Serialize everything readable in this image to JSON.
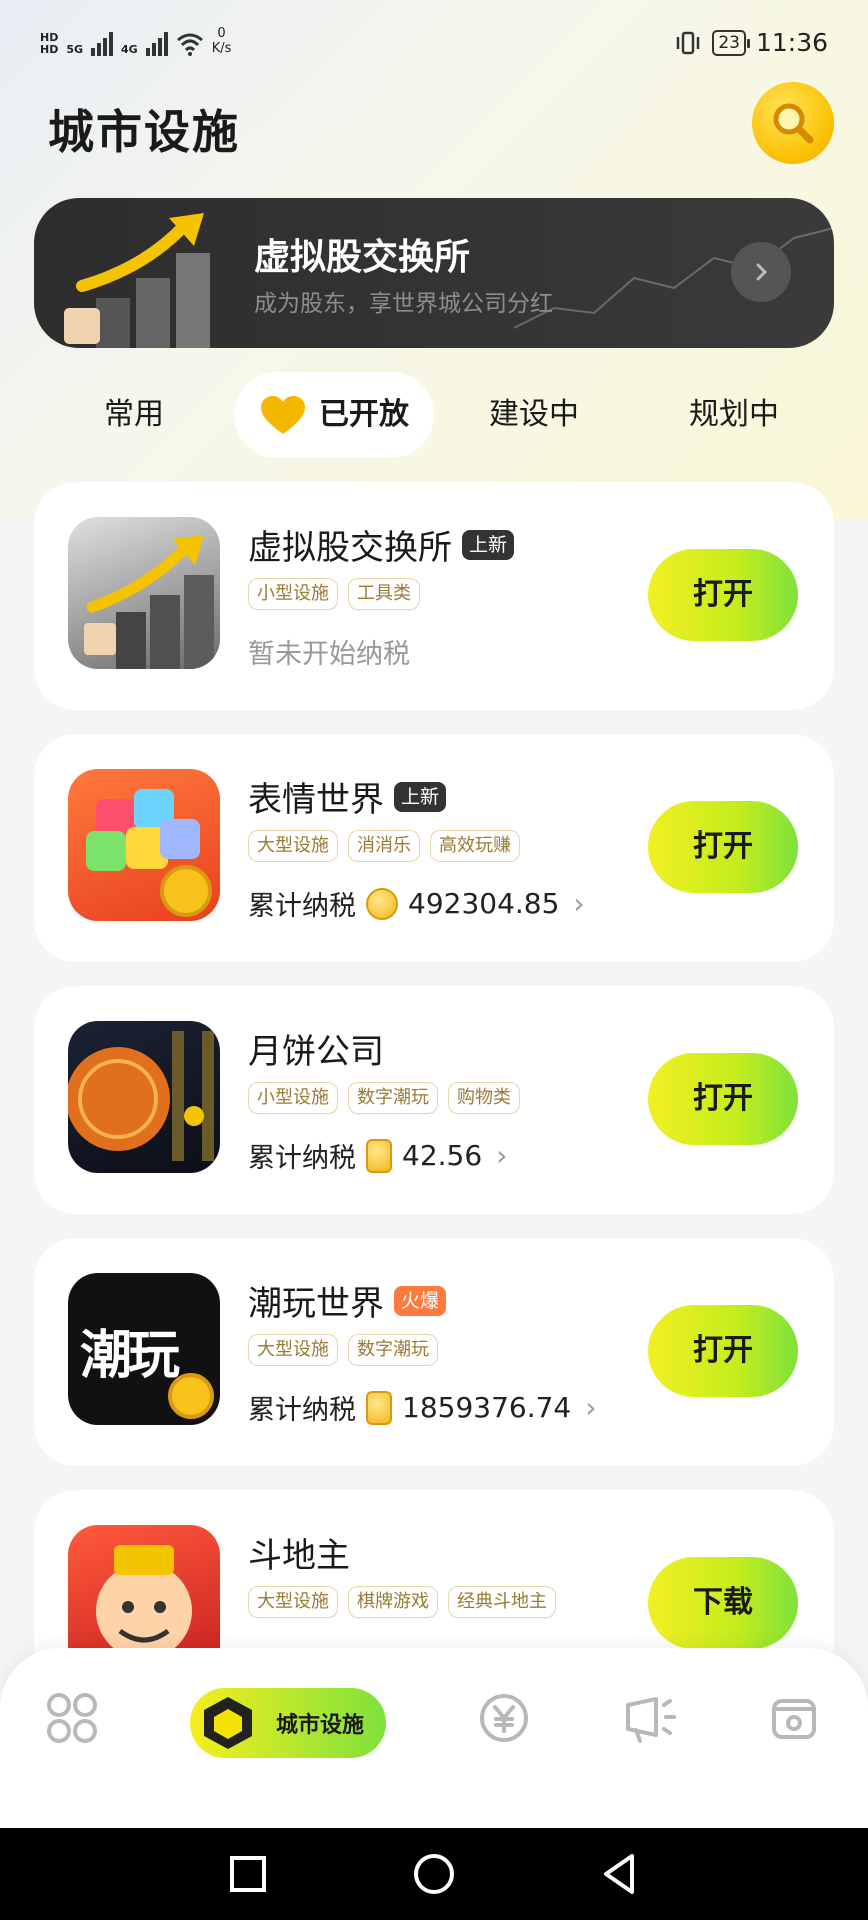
{
  "status_bar": {
    "network_tag_1": "HD",
    "network_tag_2": "HD",
    "signal_1": "5G",
    "signal_2": "4G",
    "speed_value": "0",
    "speed_unit": "K/s",
    "battery": "23",
    "time": "11:36"
  },
  "header": {
    "title": "城市设施",
    "search_icon": "search-icon"
  },
  "banner": {
    "title": "虚拟股交换所",
    "subtitle": "成为股东，享世界城公司分红",
    "arrow_icon": "chevron-right-icon"
  },
  "tabs": [
    {
      "label": "常用",
      "active": false
    },
    {
      "label": "已开放",
      "active": true,
      "icon": "heart-icon"
    },
    {
      "label": "建设中",
      "active": false
    },
    {
      "label": "规划中",
      "active": false
    }
  ],
  "facilities": [
    {
      "name": "虚拟股交换所",
      "badge": "上新",
      "tags": [
        "小型设施",
        "工具类"
      ],
      "tax_text": "暂未开始纳税",
      "action": "打开"
    },
    {
      "name": "表情世界",
      "badge": "上新",
      "tags": [
        "大型设施",
        "消消乐",
        "高效玩赚"
      ],
      "tax_label": "累计纳税",
      "tax_value": "492304.85",
      "action": "打开"
    },
    {
      "name": "月饼公司",
      "badge": "",
      "tags": [
        "小型设施",
        "数字潮玩",
        "购物类"
      ],
      "tax_label": "累计纳税",
      "tax_value": "42.56",
      "action": "打开"
    },
    {
      "name": "潮玩世界",
      "badge": "火爆",
      "tags": [
        "大型设施",
        "数字潮玩"
      ],
      "tax_label": "累计纳税",
      "tax_value": "1859376.74",
      "action": "打开",
      "icon_text": "潮玩"
    },
    {
      "name": "斗地主",
      "badge": "",
      "tags": [
        "大型设施",
        "棋牌游戏",
        "经典斗地主"
      ],
      "action": "下载"
    }
  ],
  "bottom_nav": {
    "items": [
      "grid-icon",
      "city-icon",
      "yuan-coin-icon",
      "megaphone-icon",
      "profile-card-icon"
    ],
    "active_label": "城市设施"
  },
  "colors": {
    "accent_yellow": "#f3ef22",
    "accent_green": "#7ee23c",
    "hot_badge": "#ff7a3c",
    "tag_text": "#9a7a35"
  }
}
